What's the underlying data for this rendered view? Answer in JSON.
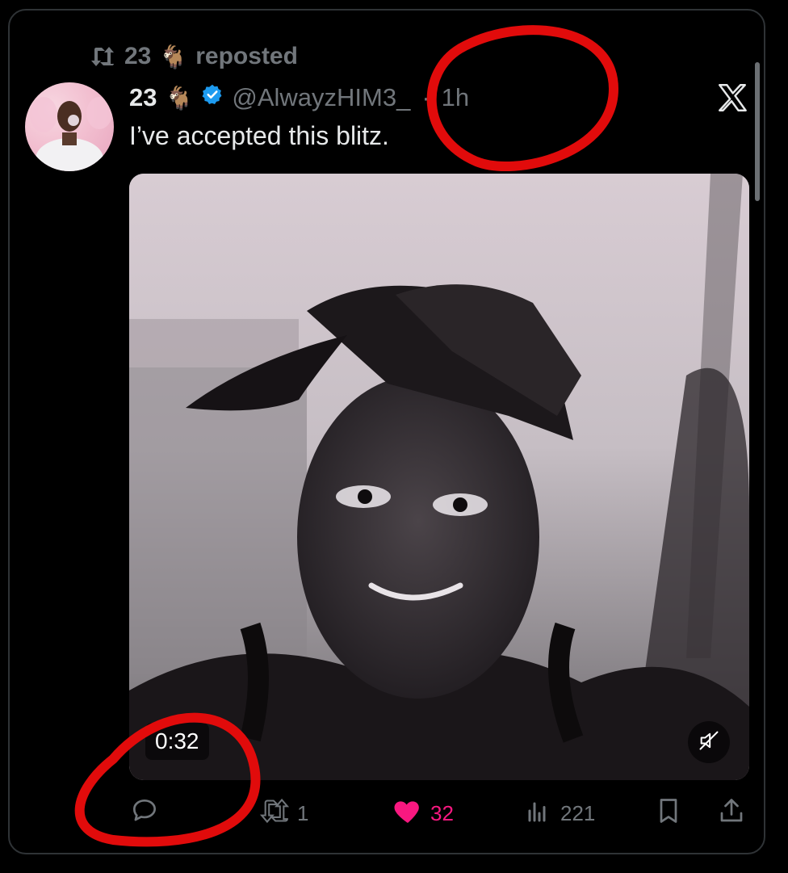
{
  "repost": {
    "reposter_name": "23",
    "emoji": "🐐",
    "label": "reposted"
  },
  "post": {
    "display_name": "23",
    "emoji": "🐐",
    "verified": true,
    "handle": "@AlwayzHIM3_",
    "separator": "·",
    "time": "1h",
    "text": "I’ve accepted this blitz."
  },
  "media": {
    "duration": "0:32",
    "muted": true
  },
  "actions": {
    "replies": "",
    "reposts": "1",
    "likes": "32",
    "views": "221"
  },
  "colors": {
    "background": "#000000",
    "text": "#e7e9ea",
    "muted_text": "#71767b",
    "verified": "#1d9bf0",
    "like": "#f91880",
    "annotation": "#e10b0b"
  },
  "icons": {
    "repost": "repost-icon",
    "goat": "goat-emoji",
    "verified": "verified-badge-icon",
    "x": "x-logo-icon",
    "mute": "speaker-muted-icon",
    "reply": "reply-icon",
    "like": "heart-icon",
    "views": "views-bar-chart-icon",
    "bookmark": "bookmark-icon",
    "share": "share-icon"
  }
}
